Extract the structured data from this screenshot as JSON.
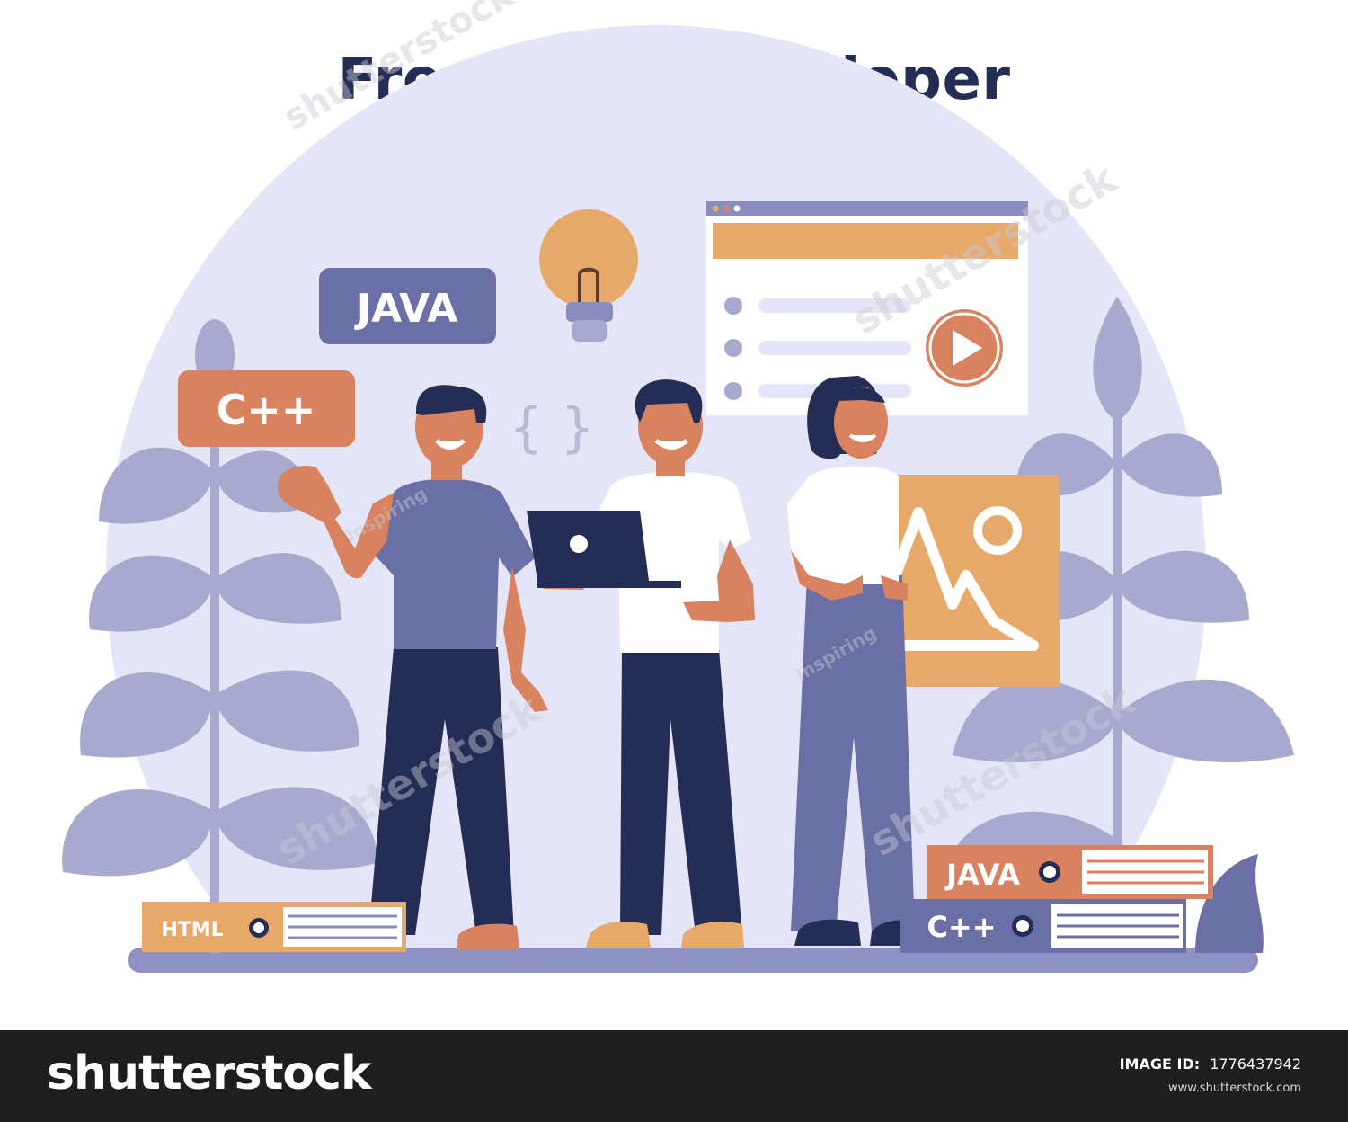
{
  "title": "Front End Developer",
  "labels": {
    "java_badge": "JAVA",
    "cpp_badge": "C++",
    "braces": "{ }",
    "book_html": "HTML",
    "book_java": "JAVA",
    "book_cpp": "C++"
  },
  "watermarks": [
    "shutterstock",
    "Inspiring"
  ],
  "footer": {
    "logo": "shutterstock",
    "image_id_label": "IMAGE ID:",
    "image_id": "1776437942",
    "site": "www.shutterstock.com"
  },
  "colors": {
    "title": "#242d55",
    "circle": "#e5e5f8",
    "leaf": "#a8a9cf",
    "badge_purple": "#6a6fa6",
    "badge_orange": "#d9825f",
    "accent_orange": "#e7a96a",
    "navy": "#232d55"
  }
}
